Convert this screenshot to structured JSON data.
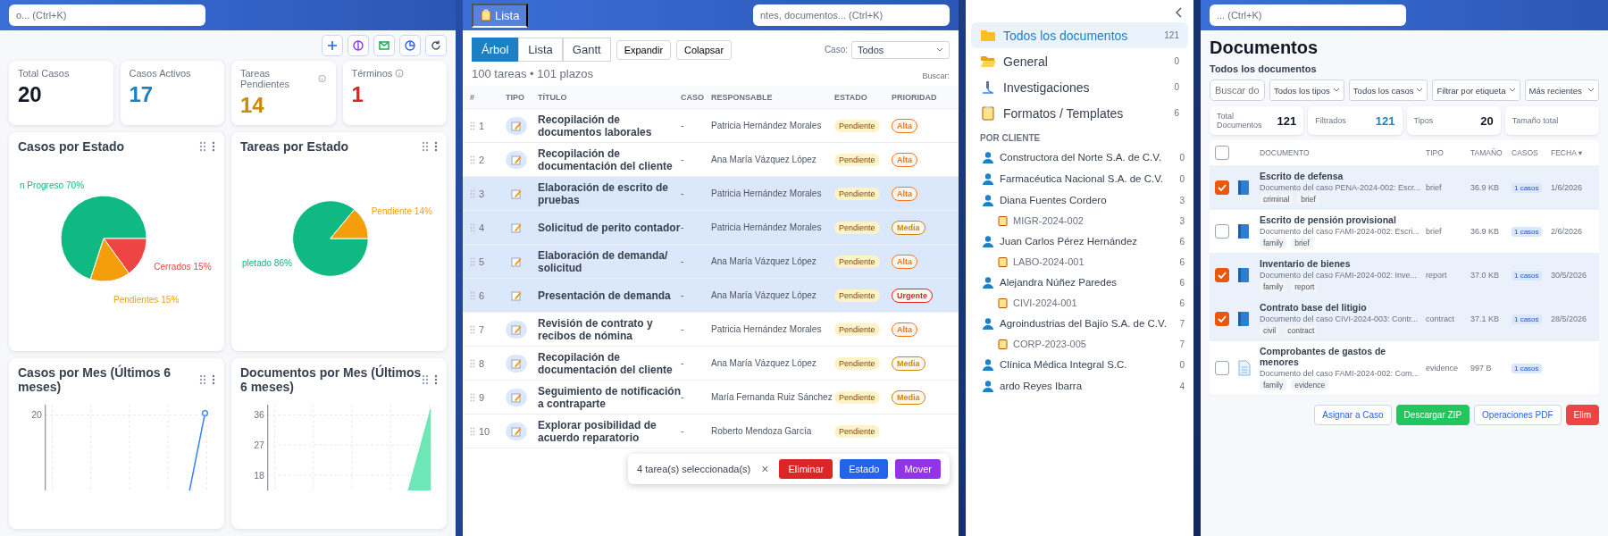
{
  "dashboard": {
    "search": {
      "placeholder": "o... (Ctrl+K)"
    },
    "stats": [
      {
        "label": "Total Casos",
        "value": "20",
        "color": "#111827",
        "info": false
      },
      {
        "label": "Casos Activos",
        "value": "17",
        "color": "#1d7fc4",
        "info": false
      },
      {
        "label": "Tareas Pendientes",
        "value": "14",
        "color": "#ca8a04",
        "info": true
      },
      {
        "label": "Términos",
        "value": "1",
        "color": "#dc2626",
        "info": true
      }
    ],
    "pie_charts": [
      {
        "chart_data": {
          "type": "pie",
          "title": "Casos por Estado",
          "values": [
            70,
            15,
            15
          ],
          "value_labels": [
            "n Progreso 70%",
            "Cerrados 15%",
            "Pendientes 15%"
          ]
        }
      },
      {
        "chart_data": {
          "type": "pie",
          "title": "Tareas por Estado",
          "values": [
            86,
            14
          ],
          "value_labels": [
            "pletado 86%",
            "Pendiente 14%"
          ]
        }
      }
    ],
    "line_charts": [
      {
        "title": "Casos por Mes (Últimos 6 meses)",
        "y_tick_labels": [
          "20"
        ]
      },
      {
        "title": "Documentos por Mes (Últimos 6 meses)",
        "y_tick_labels": [
          "36",
          "27",
          "18"
        ]
      }
    ]
  },
  "tasks": {
    "tabs": [
      {
        "label": "Lista",
        "selected": true
      }
    ],
    "search": {
      "placeholder": "ntes, documentos... (Ctrl+K)"
    },
    "views": [
      {
        "label": "Árbol",
        "selected": true
      },
      {
        "label": "Lista",
        "selected": false
      },
      {
        "label": "Gantt",
        "selected": false
      }
    ],
    "buttons": [
      "Expandir",
      "Colapsar"
    ],
    "case_filter": {
      "label": "Caso:",
      "value": "Todos"
    },
    "summary": "100 tareas • 101 plazos",
    "search_label": "Buscar:",
    "columns": [
      "#",
      "TIPO",
      "TÍTULO",
      "CASO",
      "RESPONSABLE",
      "ESTADO",
      "PRIORIDAD"
    ],
    "rows": [
      {
        "number": "1",
        "title": "Recopilación de documentos laborales",
        "case": "-",
        "owner": "Patricia Hernández Morales",
        "status": "Pendiente",
        "priority": "Alta",
        "color": "#f97316",
        "selected": false
      },
      {
        "number": "2",
        "title": "Recopilación de documentación del cliente",
        "case": "-",
        "owner": "Ana María Vázquez López",
        "status": "Pendiente",
        "priority": "Alta",
        "color": "#f97316",
        "selected": false
      },
      {
        "number": "3",
        "title": "Elaboración de escrito de pruebas",
        "case": "-",
        "owner": "Patricia Hernández Morales",
        "status": "Pendiente",
        "priority": "Alta",
        "color": "#f97316",
        "selected": true
      },
      {
        "number": "4",
        "title": "Solicitud de perito contador",
        "case": "-",
        "owner": "Patricia Hernández Morales",
        "status": "Pendiente",
        "priority": "Media",
        "color": "#ca8a04",
        "selected": true
      },
      {
        "number": "5",
        "title": "Elaboración de demanda/ solicitud",
        "case": "-",
        "owner": "Ana María Vázquez López",
        "status": "Pendiente",
        "priority": "Alta",
        "color": "#f97316",
        "selected": true
      },
      {
        "number": "6",
        "title": "Presentación de demanda",
        "case": "-",
        "owner": "Ana María Vázquez López",
        "status": "Pendiente",
        "priority": "Urgente",
        "color": "#dc2626",
        "selected": true
      },
      {
        "number": "7",
        "title": "Revisión de contrato y recibos de nómina",
        "case": "-",
        "owner": "Patricia Hernández Morales",
        "status": "Pendiente",
        "priority": "Alta",
        "color": "#f97316",
        "selected": false
      },
      {
        "number": "8",
        "title": "Recopilación de documentación del cliente",
        "case": "-",
        "owner": "Ana María Vázquez López",
        "status": "Pendiente",
        "priority": "Media",
        "color": "#ca8a04",
        "selected": false
      },
      {
        "number": "9",
        "title": "Seguimiento de notificación a contraparte",
        "case": "-",
        "owner": "María Fernanda Ruiz Sánchez",
        "status": "Pendiente",
        "priority": "Media",
        "color": "#ca8a04",
        "selected": false
      },
      {
        "number": "10",
        "title": "Explorar posibilidad de acuerdo reparatorio",
        "case": "-",
        "owner": "Roberto Mendoza García",
        "status": "Pendiente",
        "selected": false
      }
    ],
    "bulk_bar": {
      "text": "4 tarea(s) seleccionada(s)",
      "close": "×",
      "actions": [
        {
          "label": "Eliminar",
          "color": "#dc2626"
        },
        {
          "label": "Estado",
          "color": "#2563eb"
        },
        {
          "label": "Mover",
          "color": "#9333ea"
        }
      ]
    }
  },
  "folders": {
    "items": [
      {
        "kind": "folder",
        "label": "Todos los documentos",
        "count": "121",
        "selected": true
      },
      {
        "kind": "folder-open",
        "label": "General",
        "count": "0",
        "selected": false
      },
      {
        "kind": "lab",
        "label": "Investigaciones",
        "count": "0",
        "selected": false
      },
      {
        "kind": "clipboard",
        "label": "Formatos / Templates",
        "count": "6",
        "selected": false
      }
    ],
    "section": "POR CLIENTE",
    "clients": [
      {
        "label": "Constructora del Norte S.A. de C.V.",
        "count": "0"
      },
      {
        "label": "Farmacéutica Nacional S.A. de C.V.",
        "count": "0"
      },
      {
        "label": "Diana Fuentes Cordero",
        "count": "3",
        "children": [
          {
            "label": "MIGR-2024-002",
            "count": "3"
          }
        ]
      },
      {
        "label": "Juan Carlos Pérez Hernández",
        "count": "6",
        "children": [
          {
            "label": "LABO-2024-001",
            "count": "6"
          }
        ]
      },
      {
        "label": "Alejandra Núñez Paredes",
        "count": "6",
        "children": [
          {
            "label": "CIVI-2024-001",
            "count": "6"
          }
        ]
      },
      {
        "label": "Agroindustrias del Bajío S.A. de C.V.",
        "count": "7",
        "children": [
          {
            "label": "CORP-2023-005",
            "count": "7"
          }
        ]
      },
      {
        "label": "Clínica Médica Integral S.C.",
        "count": "0"
      },
      {
        "label": "ardo Reyes Ibarra",
        "count": "4"
      }
    ]
  },
  "documents": {
    "search": {
      "placeholder": "... (Ctrl+K)"
    },
    "title": "Documentos",
    "subtitle": "Todos los documentos",
    "filter_search": {
      "placeholder": "Buscar do"
    },
    "selects": [
      "Todos los tipos",
      "Todos los casos",
      "Filtrar por etiqueta",
      "Más recientes"
    ],
    "stats": [
      {
        "label": "Total Documentos",
        "value": "121"
      },
      {
        "label": "Filtrados",
        "value": "121"
      },
      {
        "label": "Tipos",
        "value": "20"
      },
      {
        "label": "Tamaño total"
      }
    ],
    "select_all": {
      "checked": false
    },
    "columns": [
      "DOCUMENTO",
      "TIPO",
      "TAMAÑO",
      "CASOS",
      "FECHA ▾"
    ],
    "rows": [
      {
        "checked": true,
        "kind": "book",
        "name": "Escrito de defensa",
        "description": "Documento del caso PENA-2024-002: Escr...",
        "tags": [
          "criminal",
          "brief"
        ],
        "type": "brief",
        "size": "36.9 KB",
        "cases": "1 casos",
        "date": "1/6/2026"
      },
      {
        "checked": false,
        "kind": "book",
        "name": "Escrito de pensión provisional",
        "description": "Documento del caso FAMI-2024-002: Escri...",
        "tags": [
          "family",
          "brief"
        ],
        "type": "brief",
        "size": "36.9 KB",
        "cases": "1 casos",
        "date": "2/6/2026"
      },
      {
        "checked": true,
        "kind": "book",
        "name": "Inventario de bienes",
        "description": "Documento del caso FAMI-2024-002: Inve...",
        "tags": [
          "family",
          "report"
        ],
        "type": "report",
        "size": "37.0 KB",
        "cases": "1 casos",
        "date": "30/5/2026"
      },
      {
        "checked": true,
        "kind": "book",
        "name": "Contrato base del litigio",
        "description": "Documento del caso CIVI-2024-003: Contr...",
        "tags": [
          "civil",
          "contract"
        ],
        "type": "contract",
        "size": "37.1 KB",
        "cases": "1 casos",
        "date": "28/5/2026"
      },
      {
        "checked": false,
        "kind": "page",
        "name": "Comprobantes de gastos de menores",
        "description": "Documento del caso FAMI-2024-002: Com...",
        "tags": [
          "family",
          "evidence"
        ],
        "type": "evidence",
        "size": "997 B",
        "cases": "1 casos"
      }
    ],
    "actions": [
      {
        "kind": "outline",
        "label": "Asignar a Caso"
      },
      {
        "kind": "green",
        "label": "Descargar ZIP"
      },
      {
        "kind": "outline",
        "label": "Operaciones PDF"
      },
      {
        "kind": "red",
        "label": "Elim"
      }
    ]
  }
}
